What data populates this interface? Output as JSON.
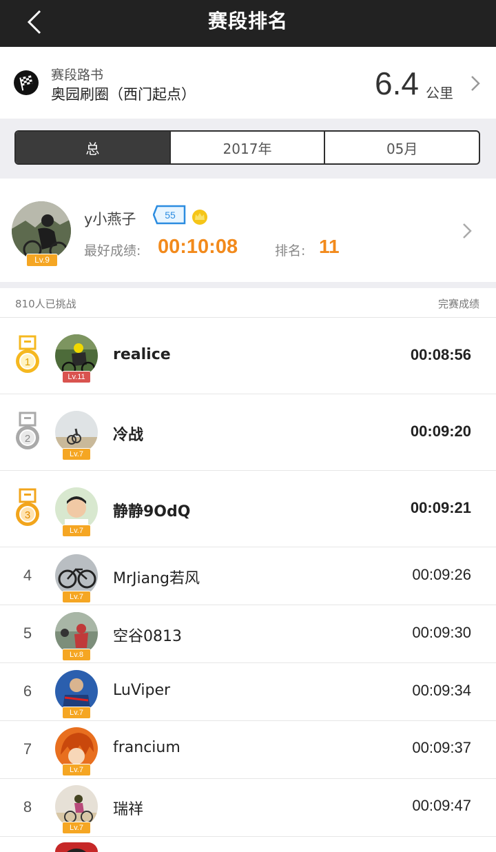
{
  "header": {
    "title": "赛段排名"
  },
  "segment": {
    "label": "赛段路书",
    "name": "奥园刷圈（西门起点）",
    "distance": "6.4",
    "unit": "公里"
  },
  "tabs": [
    {
      "label": "总",
      "active": true
    },
    {
      "label": "2017年",
      "active": false
    },
    {
      "label": "05月",
      "active": false
    }
  ],
  "me": {
    "name": "y小燕子",
    "level": "Lv.9",
    "badge_number": "55",
    "best_label": "最好成绩:",
    "best_time": "00:10:08",
    "rank_label": "排名:",
    "rank": "11"
  },
  "list": {
    "count_text": "810人已挑战",
    "column_label": "完赛成绩",
    "rows": [
      {
        "rank": "1",
        "name": "realice",
        "time": "00:08:56",
        "level": "Lv.11"
      },
      {
        "rank": "2",
        "name": "冷战",
        "time": "00:09:20",
        "level": "Lv.7"
      },
      {
        "rank": "3",
        "name": "静静9OdQ",
        "time": "00:09:21",
        "level": "Lv.7"
      },
      {
        "rank": "4",
        "name": "MrJiang若风",
        "time": "00:09:26",
        "level": "Lv.7"
      },
      {
        "rank": "5",
        "name": "空谷0813",
        "time": "00:09:30",
        "level": "Lv.8"
      },
      {
        "rank": "6",
        "name": "LuViper",
        "time": "00:09:34",
        "level": "Lv.7"
      },
      {
        "rank": "7",
        "name": "francium",
        "time": "00:09:37",
        "level": "Lv.7"
      },
      {
        "rank": "8",
        "name": "瑞祥",
        "time": "00:09:47",
        "level": "Lv.7"
      }
    ]
  },
  "colors": {
    "accent": "#f28a1c",
    "gold": "#f5b820",
    "silver": "#a9a9a9",
    "bronze": "#f2a51c",
    "topbar": "#222222"
  }
}
